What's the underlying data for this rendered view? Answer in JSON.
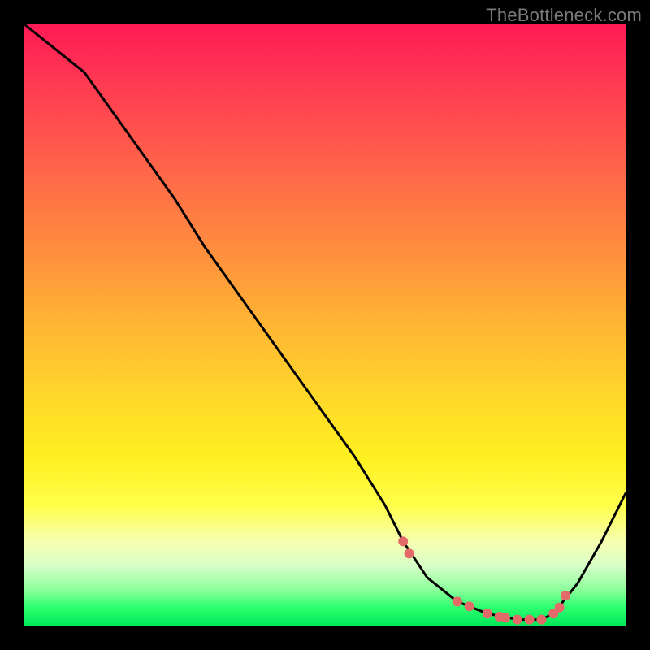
{
  "watermark": "TheBottleneck.com",
  "chart_data": {
    "type": "line",
    "title": "",
    "xlabel": "",
    "ylabel": "",
    "xlim": [
      0,
      100
    ],
    "ylim": [
      0,
      100
    ],
    "grid": false,
    "legend": false,
    "series": [
      {
        "name": "bottleneck-curve",
        "color": "#000000",
        "x": [
          0,
          5,
          10,
          15,
          20,
          25,
          30,
          35,
          40,
          45,
          50,
          55,
          60,
          63,
          67,
          72,
          77,
          82,
          86,
          88,
          92,
          96,
          100
        ],
        "y": [
          100,
          96,
          92,
          85,
          78,
          71,
          63,
          56,
          49,
          42,
          35,
          28,
          20,
          14,
          8,
          4,
          2,
          1,
          1,
          2,
          7,
          14,
          22
        ]
      }
    ],
    "markers": {
      "name": "highlight-points",
      "color": "#e46a6a",
      "radius_px": 6,
      "x": [
        63,
        64,
        72,
        74,
        77,
        79,
        80,
        82,
        84,
        86,
        88,
        89,
        90
      ],
      "y": [
        14,
        12,
        4,
        3.2,
        2,
        1.5,
        1.3,
        1,
        1,
        1,
        2,
        3,
        5
      ]
    },
    "background_gradient": {
      "orientation": "vertical",
      "stops": [
        {
          "pos": 0.0,
          "color": "#ff1a55"
        },
        {
          "pos": 0.25,
          "color": "#ff6848"
        },
        {
          "pos": 0.5,
          "color": "#ffb534"
        },
        {
          "pos": 0.72,
          "color": "#fff020"
        },
        {
          "pos": 0.86,
          "color": "#f6ffb0"
        },
        {
          "pos": 0.97,
          "color": "#2dff6e"
        },
        {
          "pos": 1.0,
          "color": "#00e85a"
        }
      ]
    }
  }
}
